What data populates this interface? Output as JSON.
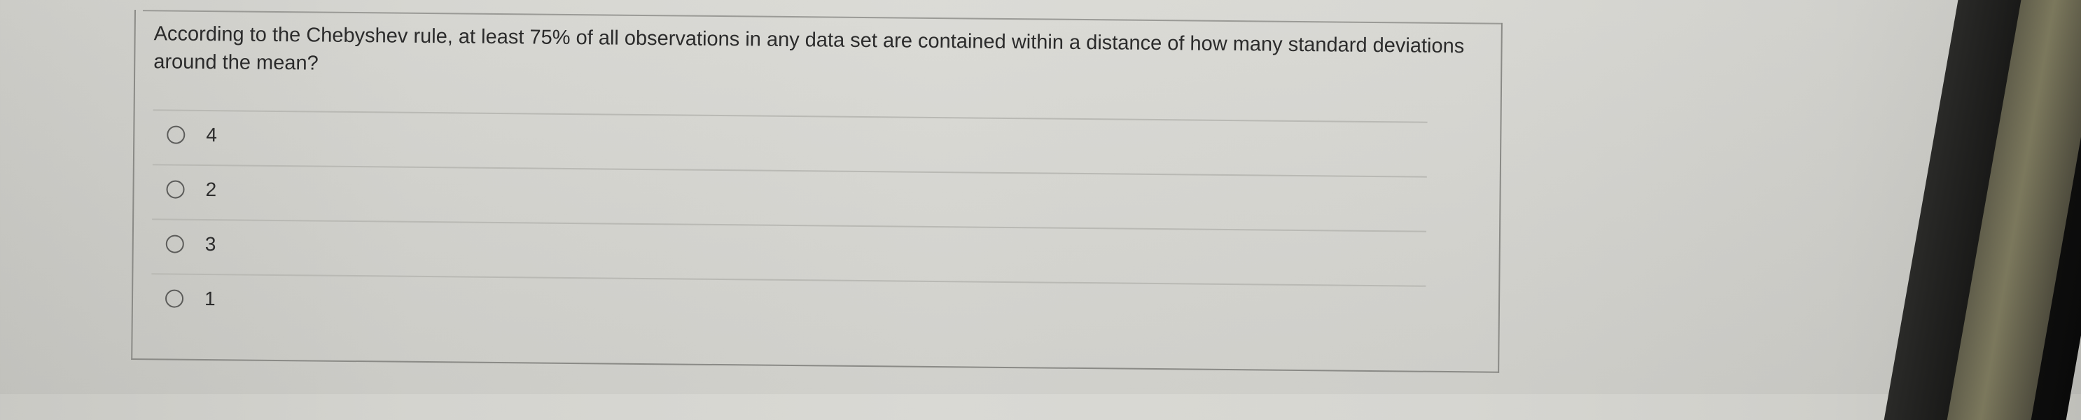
{
  "question": {
    "text": "According to the Chebyshev rule, at least 75% of all observations in any data set are contained within a distance of how many standard deviations around the mean?",
    "options": [
      {
        "label": "4"
      },
      {
        "label": "2"
      },
      {
        "label": "3"
      },
      {
        "label": "1"
      }
    ]
  },
  "colors": {
    "background": "#d6d6d1",
    "text": "#2b2b2b",
    "border": "#8a8a86",
    "divider": "#b9b9b4"
  }
}
